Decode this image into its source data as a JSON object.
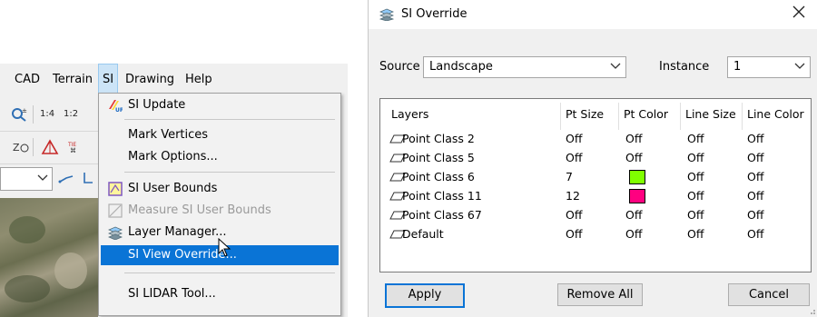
{
  "app": {
    "menubar": {
      "items": [
        {
          "label": "CAD"
        },
        {
          "label": "Terrain"
        },
        {
          "label": "SI"
        },
        {
          "label": "Drawing"
        },
        {
          "label": "Help"
        }
      ]
    },
    "toolbar": {
      "scale_a": "1:4",
      "scale_b": "1:2"
    }
  },
  "si_menu": {
    "items": [
      {
        "label": "SI Update",
        "icon": "si-update-icon"
      },
      {
        "label": "Mark Vertices"
      },
      {
        "label": "Mark Options..."
      },
      {
        "label": "SI User Bounds",
        "icon": "user-bounds-icon"
      },
      {
        "label": "Measure SI User Bounds",
        "icon": "measure-bounds-icon",
        "disabled": true
      },
      {
        "label": "Layer Manager...",
        "icon": "layers-icon"
      },
      {
        "label": "SI View Override...",
        "highlighted": true
      },
      {
        "label": "SI LIDAR Tool..."
      }
    ]
  },
  "dialog": {
    "title": "SI Override",
    "source_label": "Source",
    "source_value": "Landscape",
    "instance_label": "Instance",
    "instance_value": "1",
    "columns": [
      "Layers",
      "Pt Size",
      "Pt Color",
      "Line Size",
      "Line Color"
    ],
    "rows": [
      {
        "layer": "Point Class 2",
        "pt_size": "Off",
        "pt_color": "Off",
        "line_size": "Off",
        "line_color": "Off"
      },
      {
        "layer": "Point Class 5",
        "pt_size": "Off",
        "pt_color": "Off",
        "line_size": "Off",
        "line_color": "Off"
      },
      {
        "layer": "Point Class 6",
        "pt_size": "7",
        "pt_color_swatch": "#80ff00",
        "line_size": "Off",
        "line_color": "Off"
      },
      {
        "layer": "Point Class 11",
        "pt_size": "12",
        "pt_color_swatch": "#ff0080",
        "line_size": "Off",
        "line_color": "Off"
      },
      {
        "layer": "Point Class 67",
        "pt_size": "Off",
        "pt_color": "Off",
        "line_size": "Off",
        "line_color": "Off"
      },
      {
        "layer": "Default",
        "pt_size": "Off",
        "pt_color": "Off",
        "line_size": "Off",
        "line_color": "Off"
      }
    ],
    "buttons": {
      "apply": "Apply",
      "remove_all": "Remove All",
      "cancel": "Cancel"
    }
  },
  "colors": {
    "highlight": "#0a74d6",
    "menu_active": "#cce4f7"
  }
}
